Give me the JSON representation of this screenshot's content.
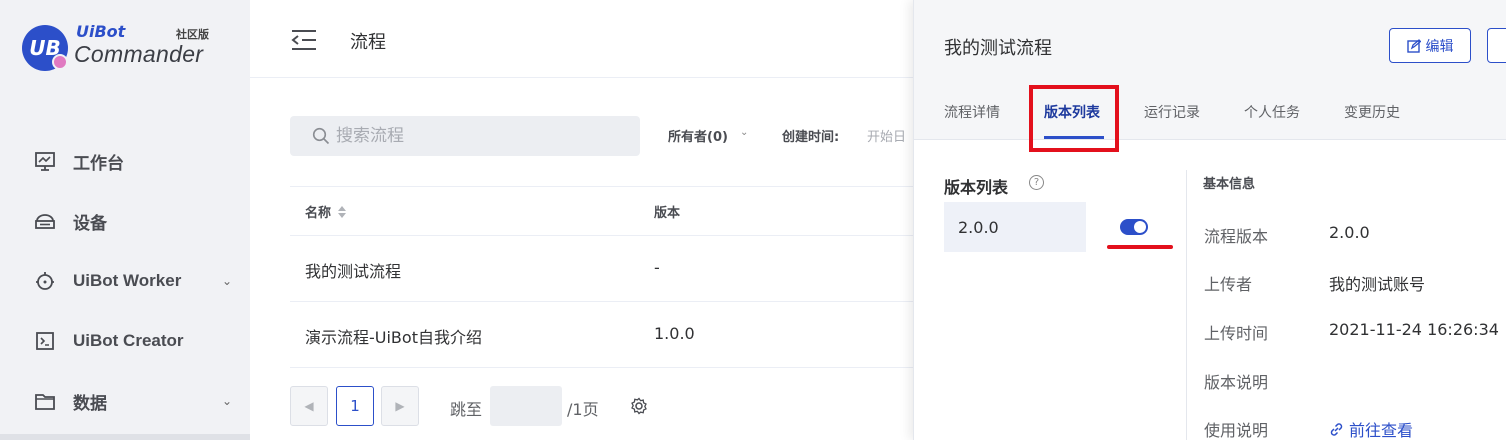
{
  "colors": {
    "accent": "#2c4fc9",
    "highlight_red": "#e3101c"
  },
  "logo": {
    "brand": "UiBot",
    "badge": "???",
    "edition": "社区版",
    "product": "Commander",
    "mark": "UB"
  },
  "sidebar": {
    "items": [
      {
        "label": "工作台",
        "icon": "monitor-icon",
        "has_chevron": false
      },
      {
        "label": "设备",
        "icon": "device-icon",
        "has_chevron": false
      },
      {
        "label": "UiBot Worker",
        "icon": "robot-icon",
        "has_chevron": true
      },
      {
        "label": "UiBot Creator",
        "icon": "terminal-icon",
        "has_chevron": false
      },
      {
        "label": "数据",
        "icon": "folder-icon",
        "has_chevron": true
      }
    ],
    "chevron": "⌄"
  },
  "header": {
    "title": "流程"
  },
  "search": {
    "placeholder": "搜索流程"
  },
  "filters": {
    "owner": "所有者(0)",
    "created_label": "创建时间:",
    "start_placeholder": "开始日"
  },
  "table": {
    "columns": [
      "名称",
      "版本"
    ],
    "rows": [
      {
        "name": "我的测试流程",
        "version": "-"
      },
      {
        "name": "演示流程-UiBot自我介绍",
        "version": "1.0.0"
      }
    ]
  },
  "pagination": {
    "current": "1",
    "jump_label": "跳至",
    "total_label": "/1页"
  },
  "drawer": {
    "title": "我的测试流程",
    "edit_label": "编辑",
    "tabs": [
      {
        "label": "流程详情",
        "active": false
      },
      {
        "label": "版本列表",
        "active": true
      },
      {
        "label": "运行记录",
        "active": false
      },
      {
        "label": "个人任务",
        "active": false
      },
      {
        "label": "变更历史",
        "active": false
      }
    ],
    "version_list": {
      "heading": "版本列表",
      "help": "?",
      "items": [
        {
          "version": "2.0.0",
          "enabled": true
        }
      ]
    },
    "basic_info": {
      "heading": "基本信息",
      "rows": [
        {
          "label": "流程版本",
          "value": "2.0.0"
        },
        {
          "label": "上传者",
          "value": "我的测试账号"
        },
        {
          "label": "上传时间",
          "value": "2021-11-24 16:26:34"
        },
        {
          "label": "版本说明",
          "value": ""
        },
        {
          "label": "使用说明",
          "value": "前往查看",
          "is_link": true
        }
      ]
    }
  }
}
